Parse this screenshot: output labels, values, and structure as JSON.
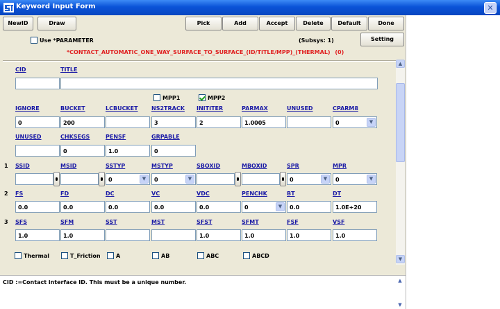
{
  "window": {
    "title": "Keyword Input Form",
    "icon": "app-logo-icon",
    "close_glyph": "✕"
  },
  "toolbar": {
    "newid": "NewID",
    "draw": "Draw",
    "pick": "Pick",
    "add": "Add",
    "accept": "Accept",
    "delete": "Delete",
    "default": "Default",
    "done": "Done",
    "setting": "Setting"
  },
  "options": {
    "use_parameter": "Use *PARAMETER",
    "use_parameter_checked": false,
    "subsys": "(Subsys: 1)"
  },
  "keyword": {
    "title": "*CONTACT_AUTOMATIC_ONE_WAY_SURFACE_TO_SURFACE_(ID/TITLE/MPP)_(THERMAL)",
    "count": "(0)"
  },
  "fields": {
    "cid": {
      "label": "CID",
      "value": ""
    },
    "title": {
      "label": "TITLE",
      "value": ""
    }
  },
  "mpp": {
    "mpp1": {
      "label": "MPP1",
      "checked": false
    },
    "mpp2": {
      "label": "MPP2",
      "checked": true
    }
  },
  "mpp_card": {
    "ignore": {
      "label": "IGNORE",
      "value": "0"
    },
    "bucket": {
      "label": "BUCKET",
      "value": "200"
    },
    "lcbucket": {
      "label": "LCBUCKET",
      "value": ""
    },
    "ns2track": {
      "label": "NS2TRACK",
      "value": "3"
    },
    "inititer": {
      "label": "INITITER",
      "value": "2"
    },
    "parmax": {
      "label": "PARMAX",
      "value": "1.0005"
    },
    "unused1": {
      "label": "UNUSED",
      "value": ""
    },
    "cparm8": {
      "label": "CPARM8",
      "value": "0"
    }
  },
  "mpp_card2": {
    "unused": {
      "label": "UNUSED",
      "value": ""
    },
    "chksegs": {
      "label": "CHKSEGS",
      "value": "0"
    },
    "pensf": {
      "label": "PENSF",
      "value": "1.0"
    },
    "grpable": {
      "label": "GRPABLE",
      "value": "0"
    }
  },
  "card1": {
    "number": "1",
    "ssid": {
      "label": "SSID",
      "value": ""
    },
    "msid": {
      "label": "MSID",
      "value": ""
    },
    "sstyp": {
      "label": "SSTYP",
      "value": "0"
    },
    "mstyp": {
      "label": "MSTYP",
      "value": "0"
    },
    "sboxid": {
      "label": "SBOXID",
      "value": ""
    },
    "mboxid": {
      "label": "MBOXID",
      "value": ""
    },
    "spr": {
      "label": "SPR",
      "value": "0"
    },
    "mpr": {
      "label": "MPR",
      "value": "0"
    }
  },
  "card2": {
    "number": "2",
    "fs": {
      "label": "FS",
      "value": "0.0"
    },
    "fd": {
      "label": "FD",
      "value": "0.0"
    },
    "dc": {
      "label": "DC",
      "value": "0.0"
    },
    "vc": {
      "label": "VC",
      "value": "0.0"
    },
    "vdc": {
      "label": "VDC",
      "value": "0.0"
    },
    "penchk": {
      "label": "PENCHK",
      "value": "0"
    },
    "bt": {
      "label": "BT",
      "value": "0.0"
    },
    "dt": {
      "label": "DT",
      "value": "1.0E+20"
    }
  },
  "card3": {
    "number": "3",
    "sfs": {
      "label": "SFS",
      "value": "1.0"
    },
    "sfm": {
      "label": "SFM",
      "value": "1.0"
    },
    "sst": {
      "label": "SST",
      "value": ""
    },
    "mst": {
      "label": "MST",
      "value": ""
    },
    "sfst": {
      "label": "SFST",
      "value": "1.0"
    },
    "sfmt": {
      "label": "SFMT",
      "value": "1.0"
    },
    "fsf": {
      "label": "FSF",
      "value": "1.0"
    },
    "vsf": {
      "label": "VSF",
      "value": "1.0"
    }
  },
  "optional_cards": {
    "thermal": "Thermal",
    "t_friction": "T_Friction",
    "a": "A",
    "ab": "AB",
    "abc": "ABC",
    "abcd": "ABCD"
  },
  "help": {
    "text": "CID :=Contact interface ID. This must be a unique number."
  },
  "glyphs": {
    "arrow_up": "▲",
    "arrow_down": "▼",
    "dropdown": "▼"
  },
  "colors": {
    "titlebar": "#0a53d8",
    "form_bg": "#ece9d8",
    "label_blue": "#1a1aa6",
    "keyword_red": "#e02020",
    "check_green": "#21a121"
  }
}
